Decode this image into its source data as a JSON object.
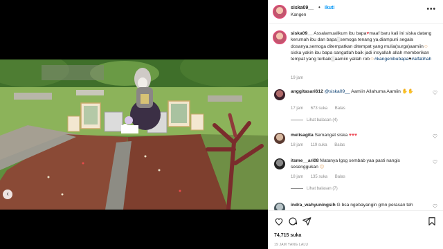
{
  "header": {
    "username": "siska09__",
    "separator": "•",
    "follow_label": "Ikuti",
    "location": "Kangen",
    "more_label": "•••"
  },
  "caption": {
    "username": "siska09__",
    "text_1": "Assalamualikum ibu bapa",
    "text_2": "maaf baru kali ini siska datang kerumah ibu dan bapa",
    "text_3": "semoga tenang ya,diampuni segala dosanya,semoga ditempatkan ditempat yang mulia(surga)aamiin",
    "text_4": "siska yakin ibu bapa sangatlah baik jadi insyallah allah memberikan tempat yang terbaik",
    "text_5": "aamiin yallah rob",
    "hashtag_1": "#kangenibubapa",
    "hashtag_2": "#alfatihah",
    "time": "19 jam"
  },
  "comments": [
    {
      "username": "anggitasari612",
      "mention": "@siska09__",
      "text": "Aamiin Allahuma Aamiin",
      "time": "17 jam",
      "likes": "673 suka",
      "reply": "Balas",
      "view_replies": "Lihat balasan (4)"
    },
    {
      "username": "melisagita",
      "text": "Semangat siska",
      "time": "18 jam",
      "likes": "119 suka",
      "reply": "Balas",
      "view_replies": ""
    },
    {
      "username": "itsme__ari08",
      "text": "Matanya lgsg sembab yaa pasti nangis sesenggukan",
      "time": "18 jam",
      "likes": "135 suka",
      "reply": "Balas",
      "view_replies": "Lihat balasan (7)"
    },
    {
      "username": "indra_wahyuningsih",
      "text": "G bsa ngebayangin gmn perasan teh",
      "time": "",
      "likes": "",
      "reply": "",
      "view_replies": ""
    }
  ],
  "footer": {
    "likes": "74,715 suka",
    "timestamp": "19 JAM YANG LALU"
  },
  "colors": {
    "link_blue": "#0095f6",
    "tag_blue": "#00376b",
    "heart_red": "#ed4956",
    "muted": "#8e8e8e"
  },
  "icons": {
    "carousel_prev": "chevron-left-icon",
    "like": "heart-icon",
    "comment": "comment-icon",
    "share": "send-icon",
    "save": "bookmark-icon"
  }
}
